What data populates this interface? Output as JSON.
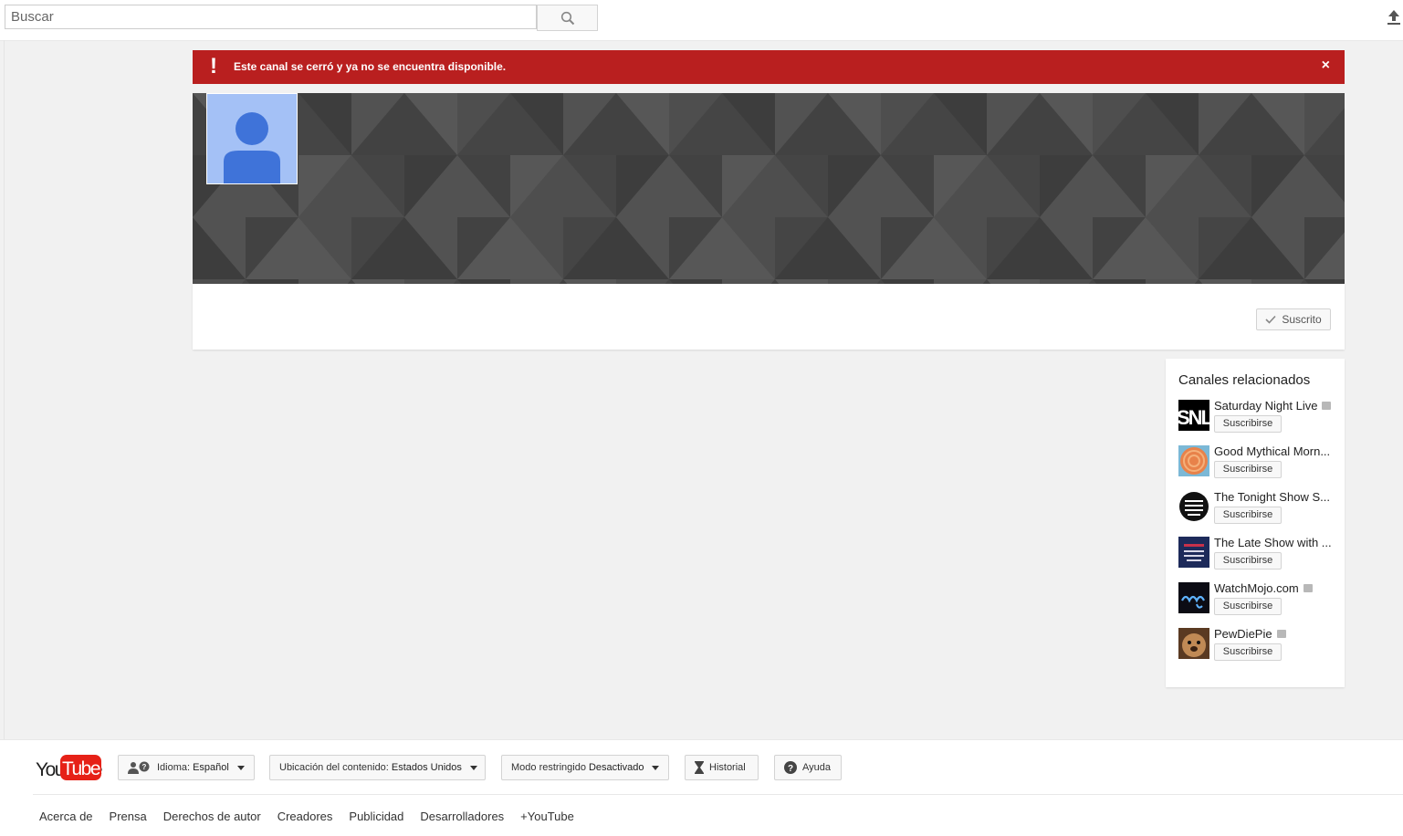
{
  "search": {
    "placeholder": "Buscar"
  },
  "alert": {
    "message": "Este canal se cerró y ya no se encuentra disponible.",
    "close": "×",
    "icon": "!"
  },
  "channel": {
    "subscribed_label": "Suscrito"
  },
  "related": {
    "title": "Canales relacionados",
    "channels": [
      {
        "name": "Saturday Night Live",
        "verified": true,
        "button": "Suscribirse",
        "thumb": "snl-logo-icon"
      },
      {
        "name": "Good Mythical Morn...",
        "verified": false,
        "button": "Suscribirse",
        "thumb": "gmm-logo-icon"
      },
      {
        "name": "The Tonight Show S...",
        "verified": false,
        "button": "Suscribirse",
        "thumb": "tonight-show-logo-icon"
      },
      {
        "name": "The Late Show with ...",
        "verified": false,
        "button": "Suscribirse",
        "thumb": "late-show-logo-icon"
      },
      {
        "name": "WatchMojo.com",
        "verified": true,
        "button": "Suscribirse",
        "thumb": "watchmojo-logo-icon"
      },
      {
        "name": "PewDiePie",
        "verified": true,
        "button": "Suscribirse",
        "thumb": "pewdiepie-avatar-icon"
      }
    ]
  },
  "footer": {
    "logo_text": "YouTube",
    "language_label": "Idioma:",
    "language_value": "Español",
    "location_label": "Ubicación del contenido:",
    "location_value": "Estados Unidos",
    "restricted_label": "Modo restringido",
    "restricted_value": "Desactivado",
    "history_label": "Historial",
    "help_label": "Ayuda",
    "links": [
      "Acerca de",
      "Prensa",
      "Derechos de autor",
      "Creadores",
      "Publicidad",
      "Desarrolladores",
      "+YouTube"
    ]
  },
  "colors": {
    "alert_red": "#b91f1f",
    "avatar_blue": "#a4c1f6",
    "avatar_figure": "#3f73d9",
    "banner_gray": "#4a4a4a"
  }
}
